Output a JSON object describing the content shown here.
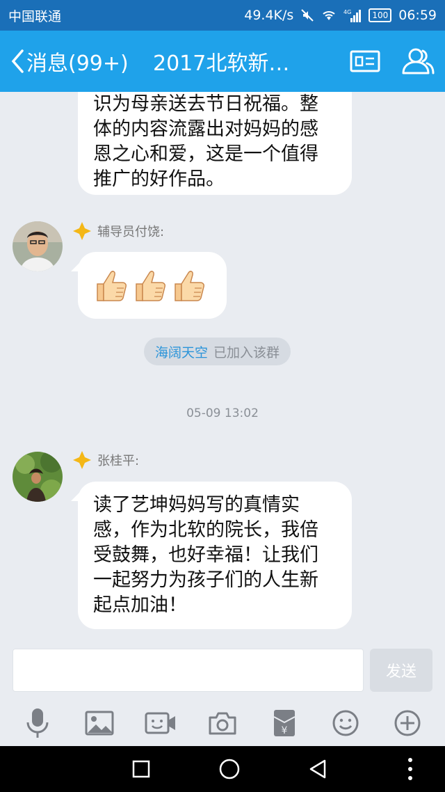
{
  "status_bar": {
    "carrier": "中国联通",
    "speed": "49.4K/s",
    "network": "4G",
    "battery": "100",
    "time": "06:59"
  },
  "header": {
    "back_label": "消息(99+)",
    "title": "2017北软新…"
  },
  "messages": {
    "first_text": "识为母亲送去节日祝福。整体的内容流露出对妈妈的感恩之心和爱，这是一个值得推广的好作品。",
    "sender1_name": "辅导员付饶:",
    "sender2_name": "张桂平:",
    "last_text": "读了艺坤妈妈写的真情实感，作为北软的院长，我倍受鼓舞，也好幸福！让我们一起努力为孩子们的人生新起点加油！"
  },
  "system": {
    "joined_name": "海阔天空",
    "joined_text": "已加入该群"
  },
  "timestamp": "05-09 13:02",
  "input": {
    "send_label": "发送"
  },
  "colors": {
    "header_blue": "#1fa2ea",
    "status_blue": "#1a6fb8",
    "chat_bg": "#e9ecf1"
  }
}
